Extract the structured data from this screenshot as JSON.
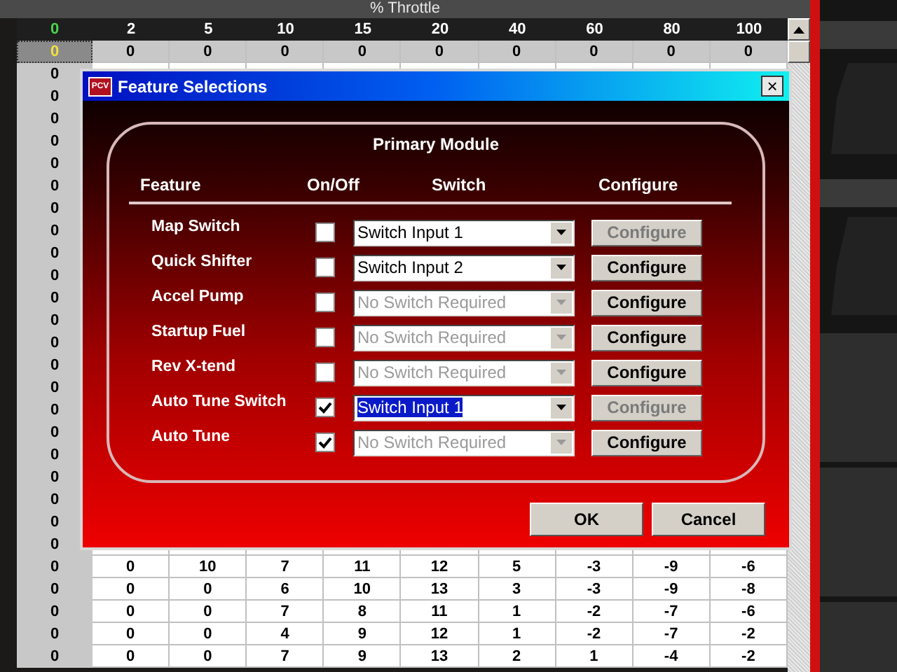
{
  "grid": {
    "title": "% Throttle",
    "corner": "0",
    "columns": [
      "2",
      "5",
      "10",
      "15",
      "20",
      "40",
      "60",
      "80",
      "100"
    ],
    "rows": [
      {
        "label": "0",
        "selected": true,
        "cells": [
          "0",
          "0",
          "0",
          "0",
          "0",
          "0",
          "0",
          "0",
          "0"
        ]
      },
      {
        "label": "0",
        "selected": false
      },
      {
        "label": "0",
        "selected": false
      },
      {
        "label": "0",
        "selected": false
      },
      {
        "label": "0",
        "selected": false
      },
      {
        "label": "0",
        "selected": false
      },
      {
        "label": "0",
        "selected": false
      },
      {
        "label": "0",
        "selected": false
      },
      {
        "label": "0",
        "selected": false
      },
      {
        "label": "0",
        "selected": false
      },
      {
        "label": "0",
        "selected": false
      },
      {
        "label": "0",
        "selected": false
      },
      {
        "label": "0",
        "selected": false
      },
      {
        "label": "0",
        "selected": false
      },
      {
        "label": "0",
        "selected": false
      },
      {
        "label": "0",
        "selected": false
      },
      {
        "label": "0",
        "selected": false
      },
      {
        "label": "0",
        "selected": false
      },
      {
        "label": "0",
        "selected": false
      },
      {
        "label": "0",
        "selected": false
      },
      {
        "label": "0",
        "selected": false
      },
      {
        "label": "0",
        "selected": false
      },
      {
        "label": "0",
        "selected": false
      },
      {
        "label": "0",
        "selected": false,
        "cells": [
          "0",
          "10",
          "7",
          "11",
          "12",
          "5",
          "-3",
          "-9",
          "-6"
        ]
      },
      {
        "label": "0",
        "selected": false,
        "cells": [
          "0",
          "0",
          "6",
          "10",
          "13",
          "3",
          "-3",
          "-9",
          "-8"
        ]
      },
      {
        "label": "0",
        "selected": false,
        "cells": [
          "0",
          "0",
          "7",
          "8",
          "11",
          "1",
          "-2",
          "-7",
          "-6"
        ]
      },
      {
        "label": "0",
        "selected": false,
        "cells": [
          "0",
          "0",
          "4",
          "9",
          "12",
          "1",
          "-2",
          "-7",
          "-2"
        ]
      },
      {
        "label": "0",
        "selected": false,
        "cells": [
          "0",
          "0",
          "7",
          "9",
          "13",
          "2",
          "1",
          "-4",
          "-2"
        ]
      }
    ]
  },
  "dialog": {
    "logo": "PCV",
    "title": "Feature Selections",
    "close": "×",
    "panel_title": "Primary Module",
    "headers": [
      "Feature",
      "On/Off",
      "Switch",
      "Configure"
    ],
    "features": [
      {
        "name": "Map Switch",
        "checked": false,
        "switch": "Switch Input 1",
        "switch_disabled": false,
        "switch_focused": false,
        "configure": "Configure",
        "configure_disabled": true
      },
      {
        "name": "Quick Shifter",
        "checked": false,
        "switch": "Switch Input 2",
        "switch_disabled": false,
        "switch_focused": false,
        "configure": "Configure",
        "configure_disabled": false
      },
      {
        "name": "Accel Pump",
        "checked": false,
        "switch": "No Switch Required",
        "switch_disabled": true,
        "switch_focused": false,
        "configure": "Configure",
        "configure_disabled": false
      },
      {
        "name": "Startup Fuel",
        "checked": false,
        "switch": "No Switch Required",
        "switch_disabled": true,
        "switch_focused": false,
        "configure": "Configure",
        "configure_disabled": false
      },
      {
        "name": "Rev X-tend",
        "checked": false,
        "switch": "No Switch Required",
        "switch_disabled": true,
        "switch_focused": false,
        "configure": "Configure",
        "configure_disabled": false
      },
      {
        "name": "Auto Tune Switch",
        "checked": true,
        "switch": "Switch Input 1",
        "switch_disabled": false,
        "switch_focused": true,
        "configure": "Configure",
        "configure_disabled": true
      },
      {
        "name": "Auto Tune",
        "checked": true,
        "switch": "No Switch Required",
        "switch_disabled": true,
        "switch_focused": false,
        "configure": "Configure",
        "configure_disabled": false
      }
    ],
    "buttons": [
      "OK",
      "Cancel"
    ]
  }
}
